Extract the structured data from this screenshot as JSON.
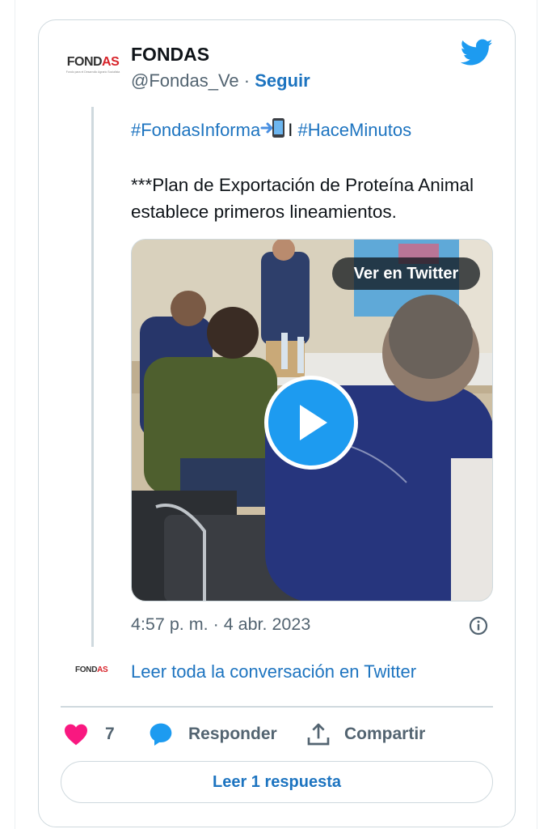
{
  "tweet": {
    "author_name": "FONDAS",
    "handle": "@Fondas_Ve",
    "separator": "·",
    "follow_label": "Seguir",
    "avatar_logo_dark": "FOND",
    "avatar_logo_red": "AS",
    "avatar_tagline": "Fondo para el Desarrollo Agrario Socialista",
    "hashtag_1": "#FondasInforma",
    "hashtag_separator": "I",
    "hashtag_2": "#HaceMinutos",
    "text": "***Plan de Exportación de Proteína Animal establece primeros lineamientos.",
    "view_on_twitter_label": "Ver en Twitter",
    "timestamp": "4:57 p. m. · 4 abr. 2023",
    "read_conversation_label": "Leer toda la conversación en Twitter",
    "likes_count": "7",
    "reply_label": "Responder",
    "share_label": "Compartir",
    "read_replies_label": "Leer 1 respuesta"
  },
  "icons": {
    "brand": "twitter-bird-icon",
    "emoji": "phone-arrow-emoji-icon",
    "play": "play-icon",
    "info": "info-icon",
    "like": "heart-icon",
    "reply": "speech-bubble-icon",
    "share": "share-upload-icon"
  },
  "colors": {
    "link_blue": "#1d74c0",
    "twitter_blue": "#1d9bf0",
    "like_pink": "#f91880",
    "muted_text": "#536471",
    "border": "#cfd9de"
  }
}
